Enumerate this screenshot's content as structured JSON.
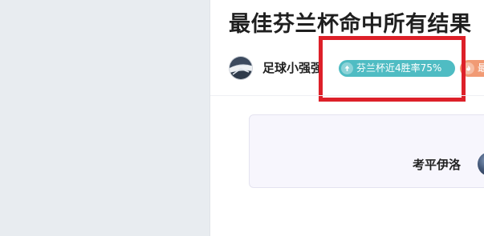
{
  "article": {
    "title": "最佳芬兰杯命中所有结果"
  },
  "author": {
    "name": "足球小强强",
    "avatar_icon": "author-avatar"
  },
  "badges": [
    {
      "label": "芬兰杯近4胜率75%",
      "icon": "arrow-up-icon",
      "color": "#4fbcc3"
    },
    {
      "label": "最",
      "icon": "flame-icon",
      "color": "#f19a74"
    }
  ],
  "highlight": {
    "color": "#dd2029"
  },
  "match_card": {
    "player_name": "考平伊洛",
    "player_avatar_icon": "player-avatar"
  }
}
